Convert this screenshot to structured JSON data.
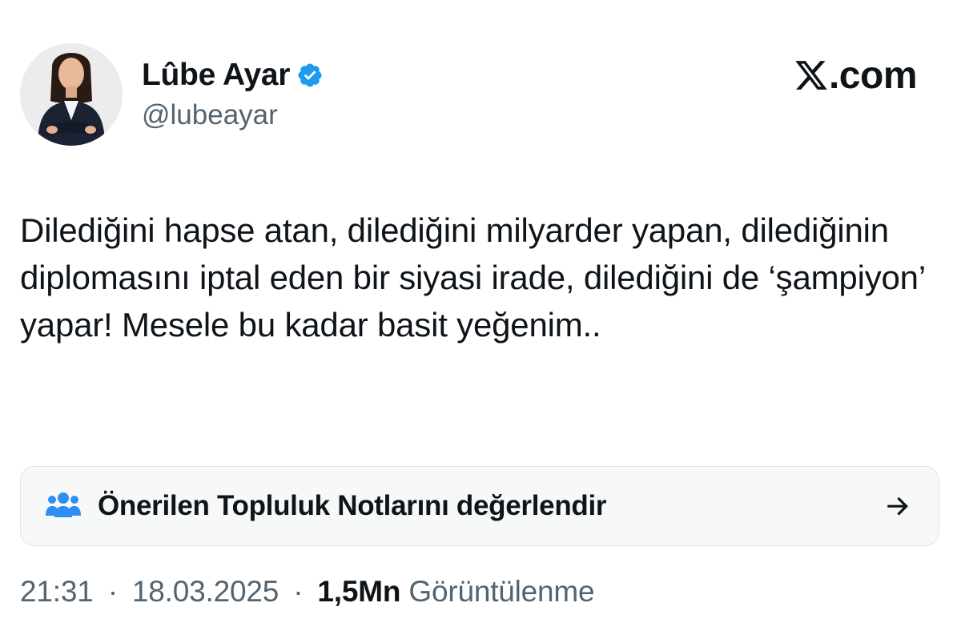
{
  "author": {
    "display_name": "Lûbe Ayar",
    "handle": "@lubeayar",
    "verified": true,
    "avatar_icon": "profile-photo"
  },
  "brand": {
    "logo_icon": "x-logo-icon",
    "text": ".com"
  },
  "tweet": {
    "text": "Dilediğini hapse atan, dilediğini milyarder yapan, dilediğinin diplomasını iptal eden bir siyasi irade, dilediğini de ‘şampiyon’ yapar! Mesele bu kadar basit yeğenim.."
  },
  "community_notes": {
    "icon": "community-icon",
    "label": "Önerilen Topluluk Notlarını değerlendir",
    "arrow_icon": "arrow-right-icon"
  },
  "meta": {
    "time": "21:31",
    "separator": "·",
    "date": "18.03.2025",
    "views_count": "1,5Mn",
    "views_label": "Görüntülenme"
  },
  "colors": {
    "verified_blue": "#1d9bf0",
    "community_blue": "#2f8ef4",
    "secondary_text": "#536471",
    "primary_text": "#0f1419"
  }
}
